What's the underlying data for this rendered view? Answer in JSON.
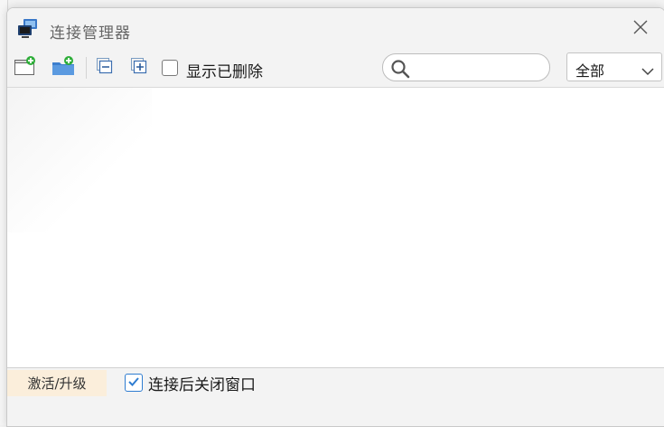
{
  "window": {
    "title": "连接管理器"
  },
  "toolbar": {
    "show_deleted_label": "显示已删除",
    "show_deleted_checked": false,
    "search_value": "",
    "search_placeholder": "",
    "filter_selected": "全部"
  },
  "footer": {
    "upgrade_label": "激活/升级",
    "close_after_connect_label": "连接后关闭窗口",
    "close_after_connect_checked": true
  },
  "colors": {
    "accent": "#2f7dd1",
    "upgrade_bg": "#fbeedb",
    "add_green": "#2fae3a"
  }
}
